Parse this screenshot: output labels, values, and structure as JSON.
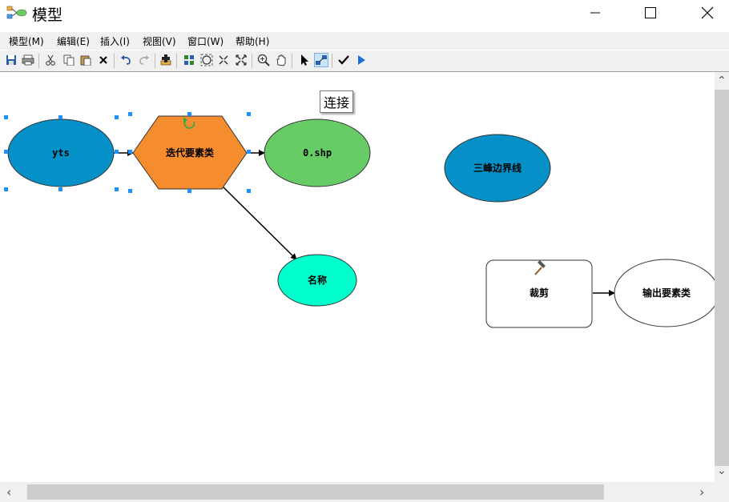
{
  "window": {
    "title": "模型"
  },
  "menu": [
    "模型(M)",
    "编辑(E)",
    "插入(I)",
    "视图(V)",
    "窗口(W)",
    "帮助(H)"
  ],
  "toolbar": {
    "items": [
      "save-icon",
      "print-icon",
      "cut-icon",
      "copy-icon",
      "paste-icon",
      "delete-icon",
      "undo-icon",
      "redo-icon",
      "add-data-icon",
      "auto-layout-icon",
      "full-extent-icon",
      "zoom-in-fixed-icon",
      "zoom-out-fixed-icon",
      "zoom-in-icon",
      "pan-icon",
      "select-icon",
      "connect-icon",
      "validate-icon",
      "run-icon"
    ],
    "active": "connect-icon"
  },
  "tooltip": "连接",
  "diagram": {
    "nodes": {
      "yts": {
        "label": "yts",
        "shape": "ellipse",
        "fill": "#0591c8"
      },
      "iterate": {
        "label": "迭代要素类",
        "shape": "hexagon",
        "fill": "#f58d2f"
      },
      "shp": {
        "label": "0.shp",
        "shape": "ellipse",
        "fill": "#67cc66"
      },
      "boundary": {
        "label": "三峰边界线",
        "shape": "ellipse",
        "fill": "#0591c8"
      },
      "name": {
        "label": "名称",
        "shape": "ellipse",
        "fill": "#00ffcc"
      },
      "clip": {
        "label": "裁剪",
        "shape": "rounded-rect",
        "fill": "#ffffff"
      },
      "output": {
        "label": "输出要素类",
        "shape": "ellipse",
        "fill": "#ffffff"
      }
    },
    "edges": [
      [
        "yts",
        "iterate"
      ],
      [
        "iterate",
        "shp"
      ],
      [
        "iterate",
        "name"
      ],
      [
        "clip",
        "output"
      ]
    ],
    "selected": [
      "yts",
      "iterate"
    ]
  }
}
